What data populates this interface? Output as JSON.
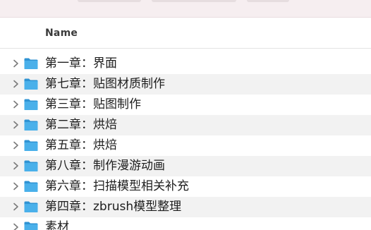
{
  "header": {
    "name_column": "Name"
  },
  "folders": [
    {
      "label": "第一章：界面",
      "icon": "folder-icon"
    },
    {
      "label": "第七章：贴图材质制作",
      "icon": "folder-icon"
    },
    {
      "label": "第三章：贴图制作",
      "icon": "folder-icon"
    },
    {
      "label": "第二章：烘焙",
      "icon": "folder-icon"
    },
    {
      "label": "第五章：烘焙",
      "icon": "folder-icon"
    },
    {
      "label": "第八章：制作漫游动画",
      "icon": "folder-icon"
    },
    {
      "label": "第六章：扫描模型相关补充",
      "icon": "folder-icon"
    },
    {
      "label": "第四章：zbrush模型整理",
      "icon": "folder-icon"
    },
    {
      "label": "素材",
      "icon": "folder-icon"
    }
  ],
  "colors": {
    "folder_front": "#4ab0ea",
    "folder_back": "#2f93d3",
    "alt_row": "#f2f2f2",
    "chevron": "#7a7a7a"
  }
}
